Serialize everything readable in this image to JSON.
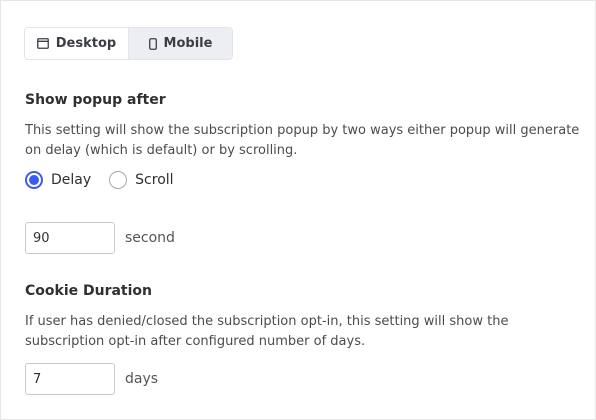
{
  "tabs": {
    "desktop_label": "Desktop",
    "desktop_icon": "desktop-window-icon",
    "mobile_label": "Mobile",
    "mobile_icon": "mobile-phone-icon",
    "active": "Mobile"
  },
  "popup": {
    "heading": "Show popup after",
    "description": "This setting will show the subscription popup by two ways either popup will generate on delay (which is default) or by scrolling.",
    "options": [
      "Delay",
      "Scroll"
    ],
    "selected": "Delay",
    "delay_value": "90",
    "delay_unit": "second"
  },
  "cookie": {
    "heading": "Cookie Duration",
    "description": "If user has denied/closed the subscription opt-in, this setting will show the subscription opt-in after configured number of days.",
    "days_value": "7",
    "days_unit": "days"
  },
  "colors": {
    "accent": "#3b5bf5",
    "tab_active_bg": "#eceef1"
  }
}
